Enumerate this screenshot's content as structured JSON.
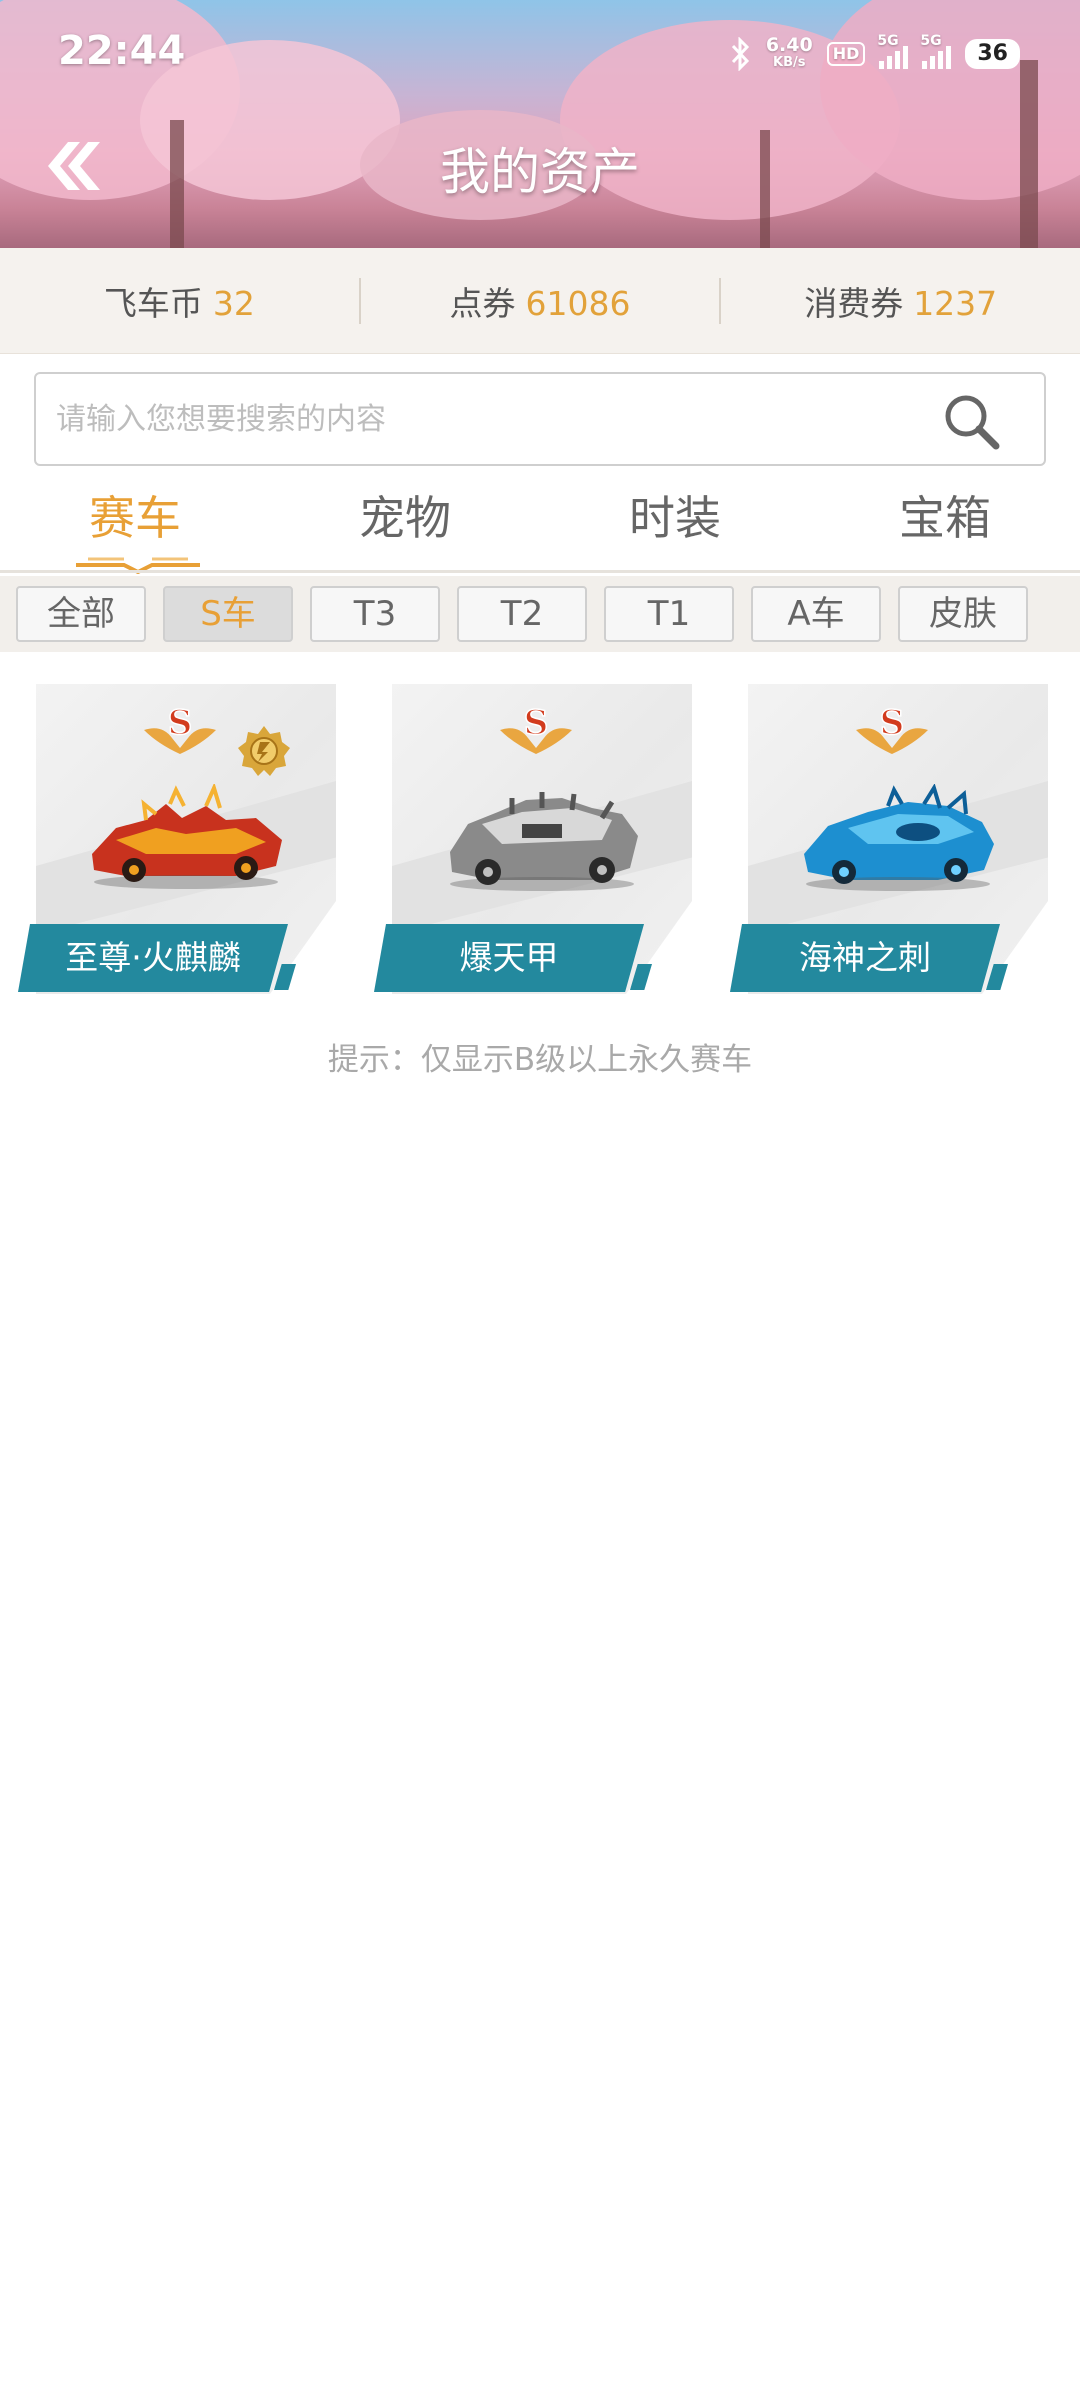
{
  "status_bar": {
    "time": "22:44",
    "net_speed": "6.40",
    "net_unit": "KB/s",
    "hd_label": "HD",
    "sim1_label": "5G",
    "sim2_label": "5G",
    "battery": "36"
  },
  "header": {
    "title": "我的资产"
  },
  "currencies": [
    {
      "label": "飞车币",
      "value": "32"
    },
    {
      "label": "点券",
      "value": "61086"
    },
    {
      "label": "消费券",
      "value": "1237"
    }
  ],
  "search": {
    "placeholder": "请输入您想要搜索的内容"
  },
  "tabs": [
    {
      "label": "赛车",
      "active": true
    },
    {
      "label": "宠物",
      "active": false
    },
    {
      "label": "时装",
      "active": false
    },
    {
      "label": "宝箱",
      "active": false
    }
  ],
  "filters": [
    {
      "label": "全部",
      "active": false
    },
    {
      "label": "S车",
      "active": true
    },
    {
      "label": "T3",
      "active": false
    },
    {
      "label": "T2",
      "active": false
    },
    {
      "label": "T1",
      "active": false
    },
    {
      "label": "A车",
      "active": false
    },
    {
      "label": "皮肤",
      "active": false
    }
  ],
  "cars": [
    {
      "name": "至尊·火麒麟",
      "rank": "S",
      "color": "#c8321e"
    },
    {
      "name": "爆天甲",
      "rank": "S",
      "color": "#8a8a8a"
    },
    {
      "name": "海神之刺",
      "rank": "S",
      "color": "#1d8fd0"
    }
  ],
  "tip": "提示：仅显示B级以上永久赛车",
  "colors": {
    "accent": "#e8a036",
    "banner": "#23899e",
    "muted": "#a9a9a9"
  }
}
